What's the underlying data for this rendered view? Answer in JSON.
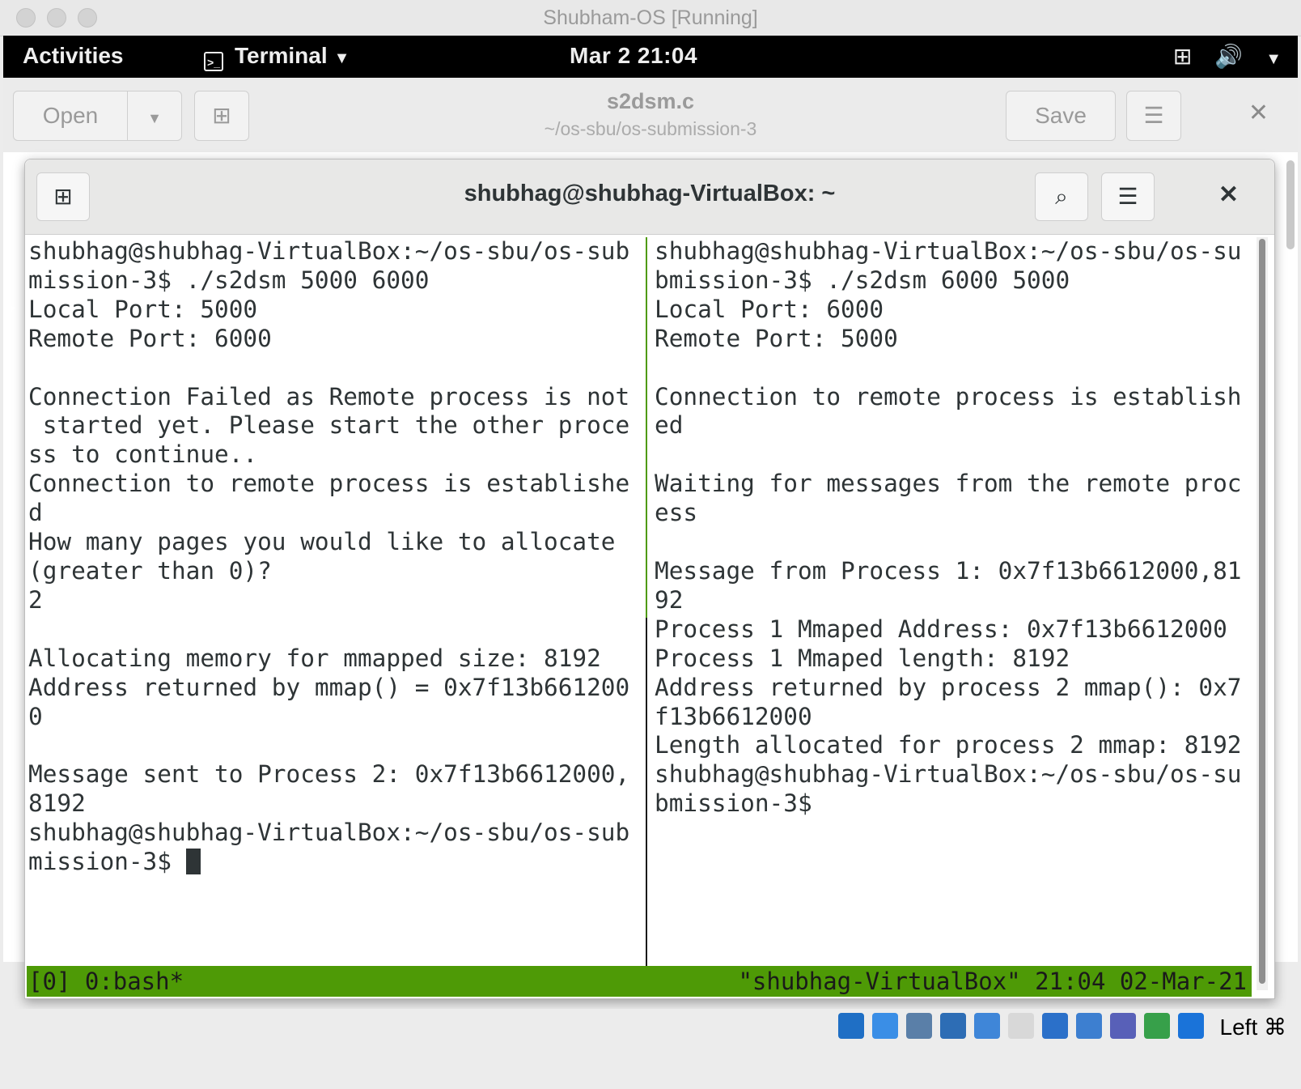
{
  "vbox": {
    "window_title": "Shubham-OS [Running]",
    "host_key": "Left ⌘",
    "icons": [
      "hard-disk-icon",
      "optical-drive-icon",
      "audio-icon",
      "network-icon",
      "usb-icon",
      "shared-folders-icon",
      "display-icon",
      "screen-icon",
      "video-capture-icon",
      "cpu-icon",
      "mouse-integration-icon"
    ]
  },
  "gnome": {
    "activities": "Activities",
    "app_name": "Terminal",
    "clock": "Mar 2  21:04"
  },
  "gedit": {
    "open_label": "Open",
    "save_label": "Save",
    "filename": "s2dsm.c",
    "path": "~/os-sbu/os-submission-3"
  },
  "terminal": {
    "title": "shubhag@shubhag-VirtualBox: ~",
    "left_pane": [
      "shubhag@shubhag-VirtualBox:~/os-sbu/os-sub",
      "mission-3$ ./s2dsm 5000 6000",
      "Local Port: 5000",
      "Remote Port: 6000",
      "",
      "Connection Failed as Remote process is not",
      " started yet. Please start the other proce",
      "ss to continue..",
      "Connection to remote process is establishe",
      "d",
      "How many pages you would like to allocate",
      "(greater than 0)?",
      "2",
      "",
      "Allocating memory for mmapped size: 8192",
      "Address returned by mmap() = 0x7f13b661200",
      "0",
      "",
      "Message sent to Process 2: 0x7f13b6612000,",
      "8192",
      "shubhag@shubhag-VirtualBox:~/os-sbu/os-sub",
      "mission-3$ "
    ],
    "right_pane": [
      "shubhag@shubhag-VirtualBox:~/os-sbu/os-su",
      "bmission-3$ ./s2dsm 6000 5000",
      "Local Port: 6000",
      "Remote Port: 5000",
      "",
      "Connection to remote process is establish",
      "ed",
      "",
      "Waiting for messages from the remote proc",
      "ess",
      "",
      "Message from Process 1: 0x7f13b6612000,81",
      "92",
      "Process 1 Mmaped Address: 0x7f13b6612000",
      "Process 1 Mmaped length: 8192",
      "Address returned by process 2 mmap(): 0x7",
      "f13b6612000",
      "Length allocated for process 2 mmap: 8192",
      "shubhag@shubhag-VirtualBox:~/os-sbu/os-su",
      "bmission-3$"
    ],
    "tmux_left": "[0] 0:bash*",
    "tmux_right": "\"shubhag-VirtualBox\" 21:04 02-Mar-21"
  },
  "colors": {
    "tmux_status": "#4e9a06",
    "terminal_text": "#2e3436"
  }
}
